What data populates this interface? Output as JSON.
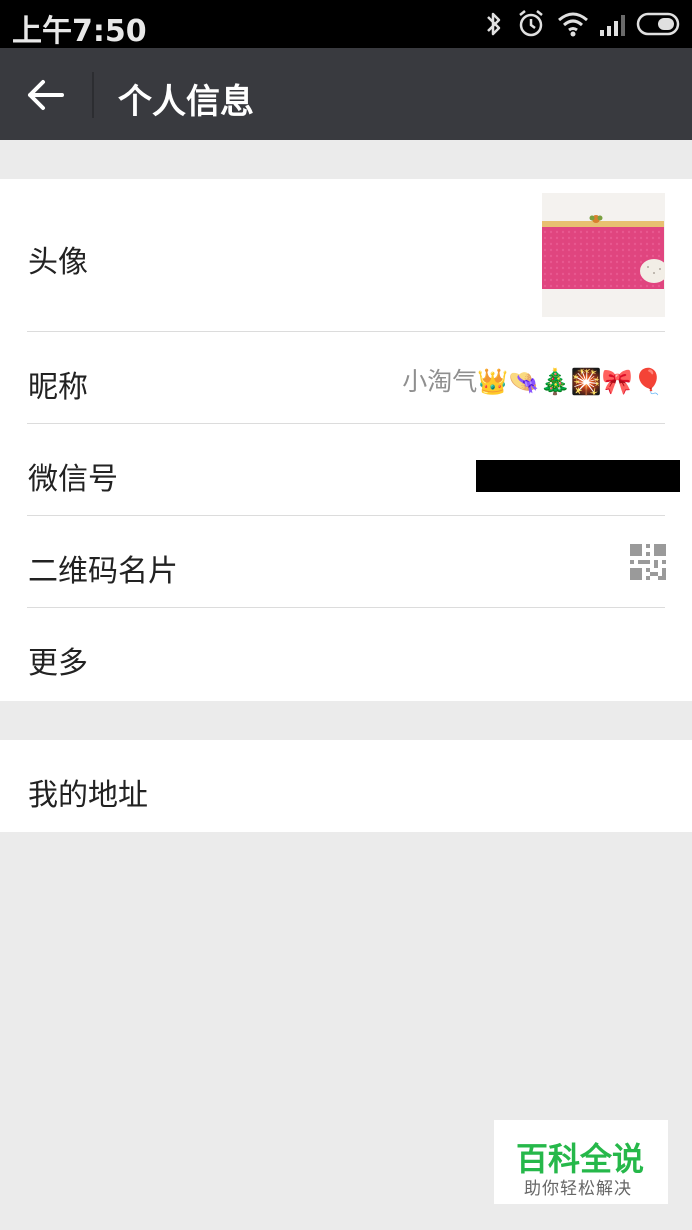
{
  "status_bar": {
    "time": "上午7:50",
    "icons": [
      "bluetooth-icon",
      "alarm-icon",
      "wifi-icon",
      "signal-icon",
      "battery-icon"
    ]
  },
  "header": {
    "title": "个人信息",
    "back_icon": "arrow-left-icon",
    "background": "#393a3f"
  },
  "profile_group": {
    "avatar": {
      "label": "头像"
    },
    "nickname": {
      "label": "昵称",
      "value": "小淘气👑👒🎄🎇🎀🎈"
    },
    "wechat_id": {
      "label": "微信号",
      "value_redacted": true
    },
    "qr_card": {
      "label": "二维码名片",
      "icon": "qr-code-icon"
    },
    "more": {
      "label": "更多"
    }
  },
  "address_group": {
    "my_address": {
      "label": "我的地址"
    }
  },
  "watermark": {
    "title": "百科全说",
    "subtitle": "助你轻松解决",
    "color": "#26b84a"
  }
}
